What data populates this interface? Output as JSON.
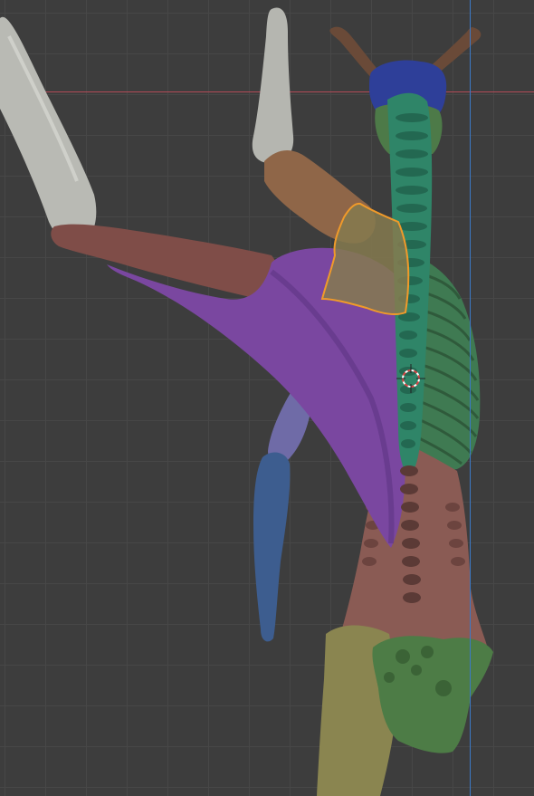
{
  "app": {
    "view": "3D viewport",
    "mode": "sculpt"
  },
  "colors": {
    "background": "#3d3d3d",
    "grid_line": "#474747",
    "x_axis": "#b24a57",
    "y_axis": "#3b79c7",
    "bone_grey": "#b9bab4",
    "upper_arm_brown": "#8f6648",
    "forearm_rose": "#7f4d48",
    "latissimus_purple": "#7a47a0",
    "trapezius_selected_olive": "#857a4f",
    "selection_outline": "#f09a2a",
    "spine_teal": "#2f8568",
    "ribs_green": "#3f7a52",
    "lower_back_rose": "#8a5b54",
    "pelvis_olive": "#8a8550",
    "sacrum_green": "#4d7c46",
    "skull_blue": "#2e3f99",
    "humerus_lavender": "#6f6ba7",
    "forearm_blue": "#3d5d8f",
    "antler_brown": "#6a4a38",
    "cursor_red": "#d84545"
  },
  "objects": [
    "skull",
    "antlers",
    "cervical-spine",
    "thoracic-spine",
    "ribcage",
    "lumbar-region",
    "pelvis",
    "sacrum",
    "scapula-left",
    "latissimus-dorsi",
    "upper-arm",
    "forearm",
    "hand-bones",
    "second-arm-upper",
    "second-arm-lower",
    "bone-top"
  ],
  "selected_object": "scapula-left",
  "cursor": "3d-cursor"
}
